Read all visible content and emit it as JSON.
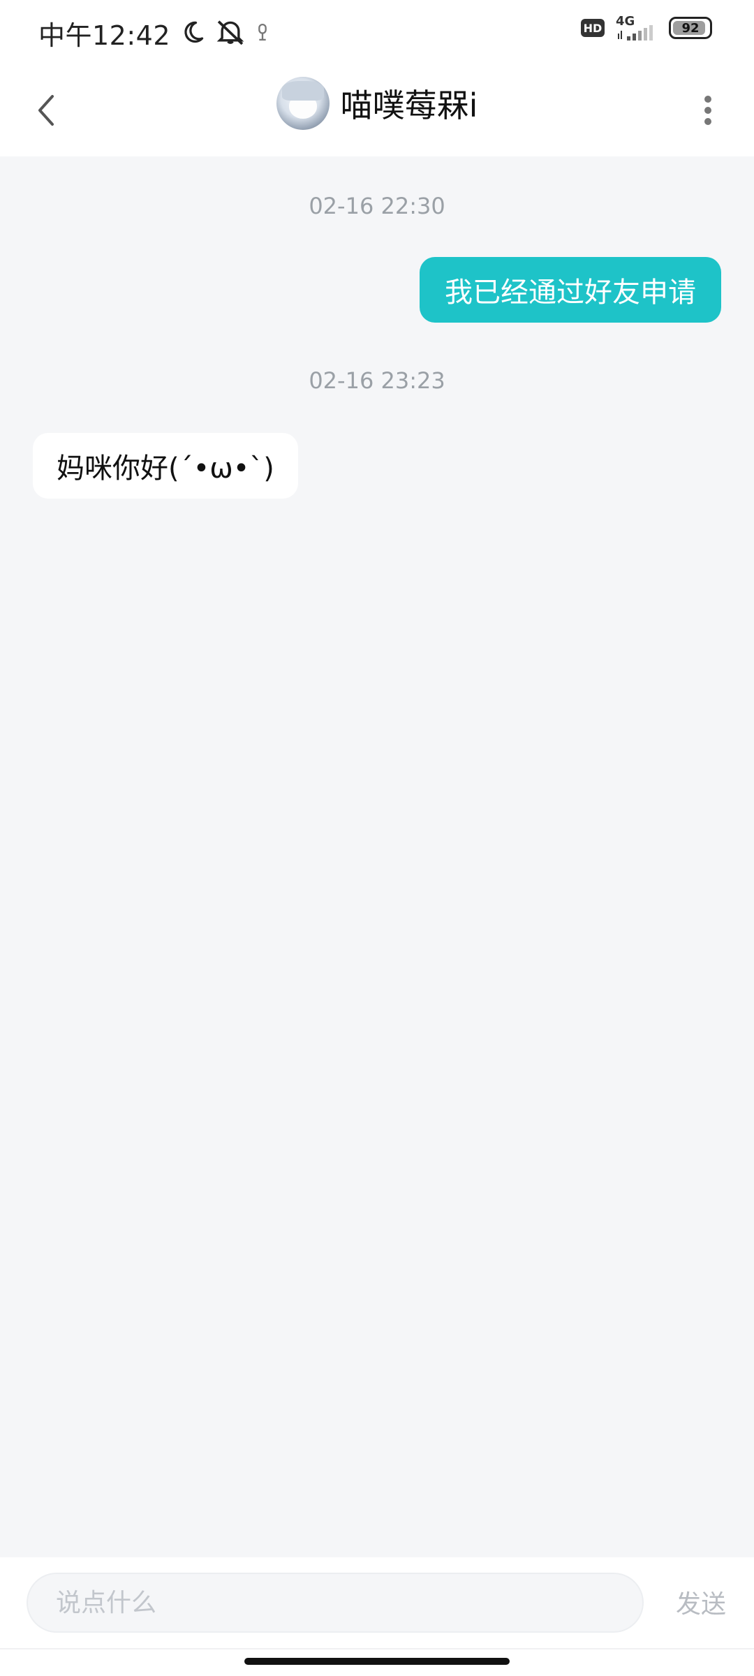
{
  "status_bar": {
    "time": "中午12:42",
    "hd_badge": "HD",
    "network": "4G",
    "battery": "92",
    "icons": [
      "moon-icon",
      "mute-icon",
      "alarm-icon",
      "hd-icon",
      "signal-icon",
      "battery-icon"
    ]
  },
  "nav": {
    "title": "喵噗莓槑i",
    "back_icon": "chevron-left-icon",
    "more_icon": "more-vertical-icon"
  },
  "chat": {
    "messages": [
      {
        "timestamp": "02-16 22:30",
        "direction": "outgoing",
        "text": "我已经通过好友申请"
      },
      {
        "timestamp": "02-16 23:23",
        "direction": "incoming",
        "text": "妈咪你好(´•ω•`)"
      }
    ]
  },
  "input": {
    "placeholder": "说点什么",
    "send_label": "发送"
  },
  "colors": {
    "accent": "#1ec3c8",
    "background": "#f5f6f8",
    "muted_text": "#9aa0a6"
  }
}
